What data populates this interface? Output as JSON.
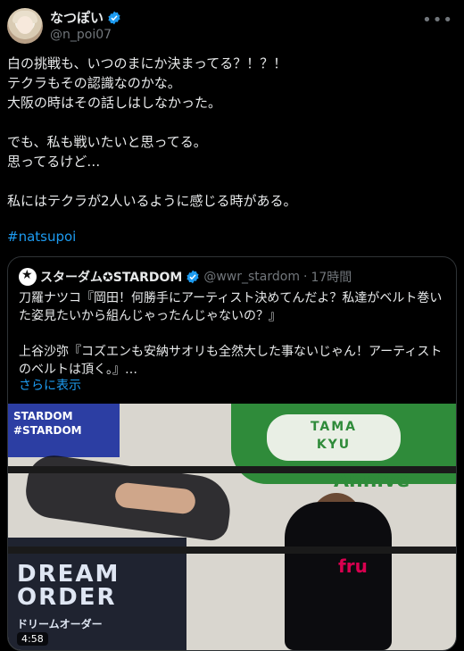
{
  "author": {
    "name": "なつぽい",
    "handle": "@n_poi07"
  },
  "post": {
    "text": "白の挑戦も、いつのまにか決まってる？！？！\nテクラもその認識なのかな。\n大阪の時はその話しはしなかった。\n\nでも、私も戦いたいと思ってる。\n思ってるけど…\n\n私にはテクラが2人いるように感じる時がある。",
    "hashtag": "#natsupoi"
  },
  "quote": {
    "name": "スターダム✪STARDOM",
    "handle": "@wwr_stardom",
    "separator": "·",
    "time": "17時間",
    "text": "刀羅ナツコ『岡田！何勝手にアーティスト決めてんだよ？私達がベルト巻いた姿見たいから組んじゃったんじゃないの？』\n\n上谷沙弥『コズエンも安納サオリも全然大した事ないじゃん！アーティストのベルトは頂く。』…",
    "show_more": "さらに表示"
  },
  "media": {
    "banner_line1": "STARDOM",
    "banner_line2": "#STARDOM",
    "tama_line1": "TAMA",
    "tama_line2": "KYU",
    "anniversary": "Annive",
    "dream_line1": "DREAM",
    "dream_line2": "ORDER",
    "dream_sub": "ドリームオーダー",
    "ad_text": "fru",
    "duration": "4:58"
  },
  "colors": {
    "accent": "#1d9bf0",
    "background": "#000000",
    "verified": "#1d9bf0"
  },
  "icons": {
    "more": "more-horizontal-icon",
    "verified": "verified-badge-icon"
  }
}
